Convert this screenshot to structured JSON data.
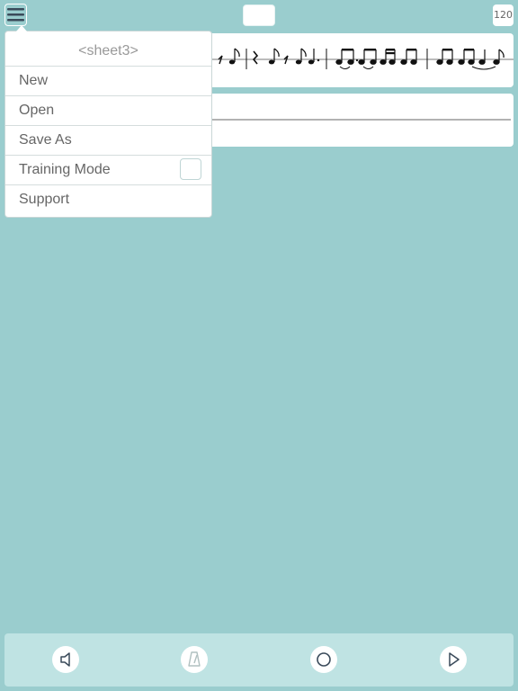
{
  "toolbar": {
    "menu_icon": "hamburger-icon",
    "title": "",
    "tempo": "120"
  },
  "menu": {
    "sheet_name": "<sheet3>",
    "items": [
      {
        "label": "New"
      },
      {
        "label": "Open"
      },
      {
        "label": "Save As"
      },
      {
        "label": "Training Mode",
        "checked": false
      },
      {
        "label": "Support"
      }
    ]
  },
  "controls": {
    "sound": "speaker-icon",
    "metronome": "metronome-icon",
    "loop": "loop-icon",
    "play": "play-icon"
  },
  "colors": {
    "background": "#9acdce",
    "bottom_bar": "#bfe3e3",
    "accent_dark": "#3a4a5a"
  }
}
